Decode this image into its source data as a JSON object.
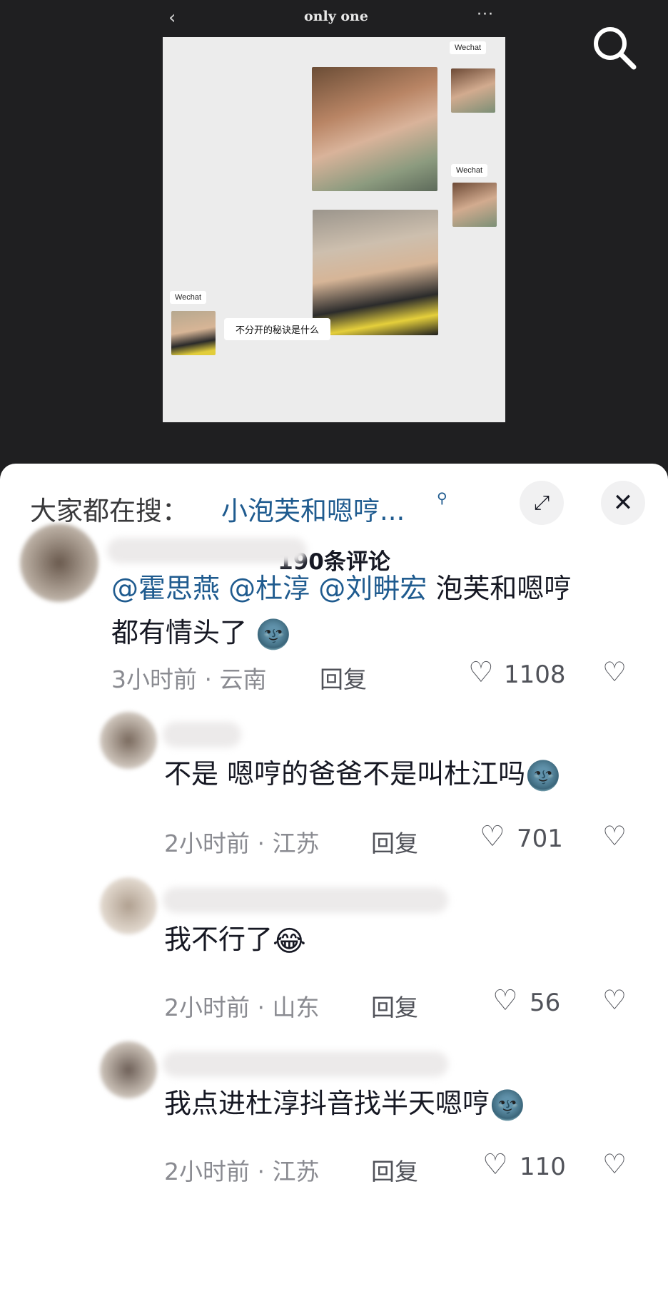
{
  "chat": {
    "title": "only one",
    "back_icon": "‹",
    "more_icon": "···",
    "tag_label": "Wechat",
    "message": "不分开的秘诀是什么"
  },
  "hot_search": {
    "prefix": "大家都在搜：",
    "term": "小泡芙和嗯哼...",
    "expand_icon": "⤢",
    "close_icon": "✕"
  },
  "comment_count": "190条评论",
  "reply_label": "回复",
  "like_icon": "♡",
  "dislike_icon": "♡",
  "comments": [
    {
      "mentions": [
        "@霍思燕",
        "@杜淳",
        "@刘畊宏"
      ],
      "text_after": "泡芙和嗯哼",
      "text_line2": "都有情头了",
      "emoji": "🌚",
      "meta": "3小时前 · 云南",
      "likes": "1108"
    },
    {
      "text": "不是 嗯哼的爸爸不是叫杜江吗",
      "emoji": "🌚",
      "meta": "2小时前 · 江苏",
      "likes": "701"
    },
    {
      "text": "我不行了",
      "emoji": "😂",
      "meta": "2小时前 · 山东",
      "likes": "56"
    },
    {
      "text": "我点进杜淳抖音找半天嗯哼",
      "emoji": "🌚",
      "meta": "2小时前 · 江苏",
      "likes": "110"
    }
  ]
}
